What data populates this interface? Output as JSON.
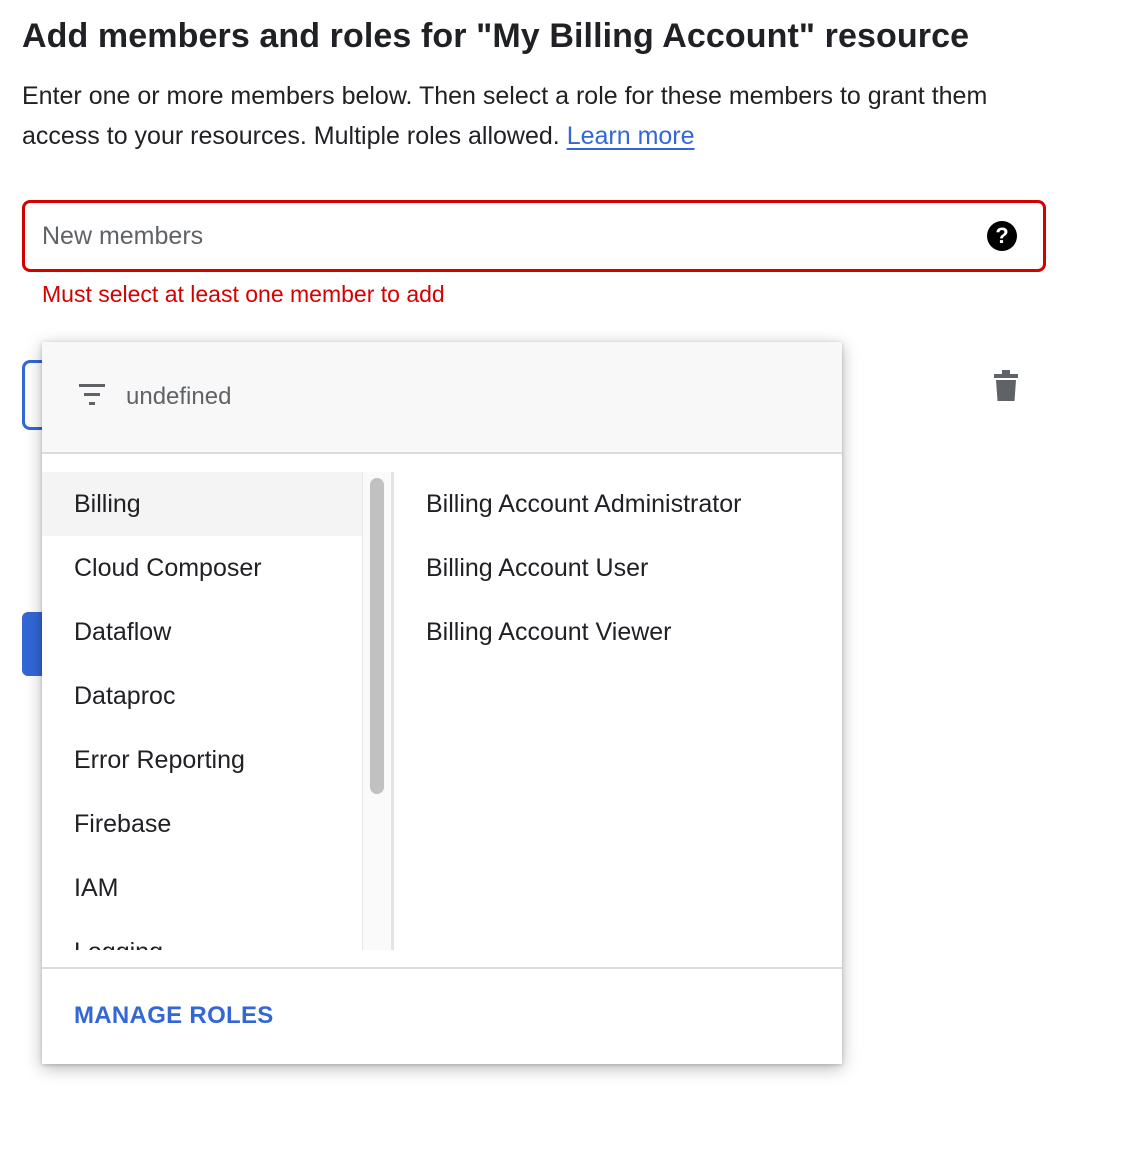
{
  "page": {
    "title": "Add members and roles for \"My Billing Account\" resource",
    "description": "Enter one or more members below. Then select a role for these members to grant them access to your resources. Multiple roles allowed.",
    "learn_more": "Learn more"
  },
  "members_field": {
    "placeholder": "New members",
    "help_icon": "help-icon",
    "error": "Must select at least one member to add"
  },
  "role_picker": {
    "filter_placeholder": "undefined",
    "categories": [
      {
        "label": "Billing",
        "selected": true
      },
      {
        "label": "Cloud Composer"
      },
      {
        "label": "Dataflow"
      },
      {
        "label": "Dataproc"
      },
      {
        "label": "Error Reporting"
      },
      {
        "label": "Firebase"
      },
      {
        "label": "IAM"
      },
      {
        "label": "Logging"
      }
    ],
    "roles": [
      {
        "label": "Billing Account Administrator"
      },
      {
        "label": "Billing Account User"
      },
      {
        "label": "Billing Account Viewer"
      }
    ],
    "manage_roles": "MANAGE ROLES"
  },
  "colors": {
    "error": "#d50000",
    "accent": "#3367d6"
  }
}
